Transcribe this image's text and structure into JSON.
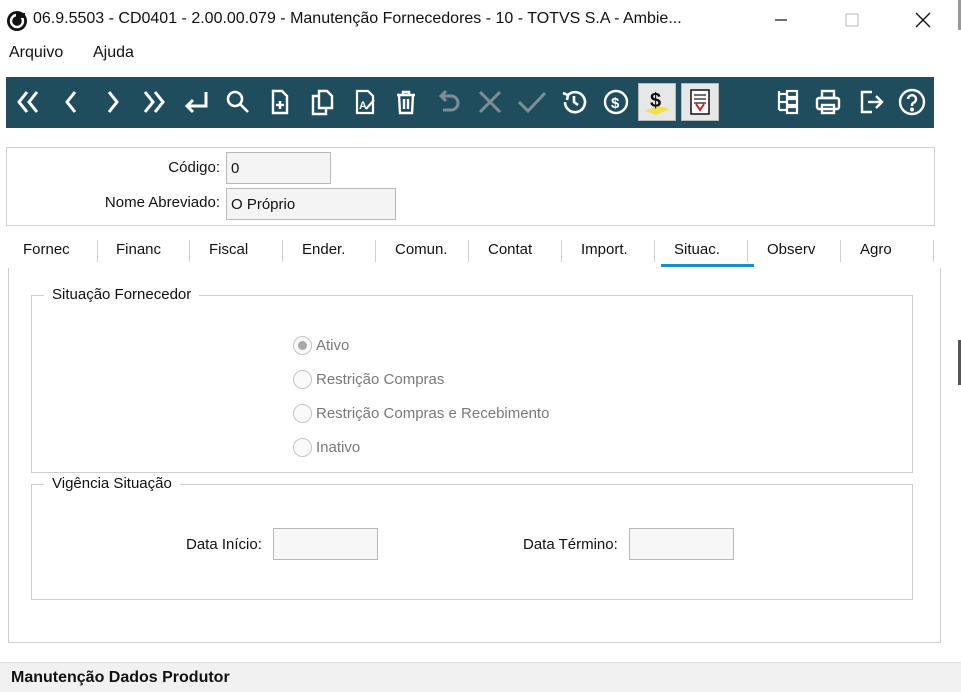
{
  "window": {
    "title": "06.9.5503 - CD0401 - 2.00.00.079 - Manutenção Fornecedores - 10 - TOTVS S.A - Ambie...",
    "controls": {
      "minimize": "minimize-icon",
      "maximize": "maximize-icon",
      "close": "close-icon"
    }
  },
  "menu": {
    "items": [
      "Arquivo",
      "Ajuda"
    ]
  },
  "toolbar": {
    "background": "#1f4d5e",
    "buttons": [
      "first-record-icon",
      "previous-record-icon",
      "next-record-icon",
      "last-record-icon",
      "goto-icon",
      "search-icon",
      "new-record-icon",
      "copy-record-icon",
      "edit-record-icon",
      "delete-icon",
      "undo-icon",
      "cancel-icon",
      "save-icon",
      "history-icon",
      "money-circle-icon",
      "dollar-icon",
      "report-icon",
      "tree-icon",
      "print-icon",
      "exit-icon",
      "help-icon"
    ]
  },
  "header": {
    "codigo_label": "Código:",
    "codigo_value": "0",
    "nome_label": "Nome Abreviado:",
    "nome_value": "O Próprio"
  },
  "tabs": {
    "items": [
      "Fornec",
      "Financ",
      "Fiscal",
      "Ender.",
      "Comun.",
      "Contat",
      "Import.",
      "Situac.",
      "Observ",
      "Agro"
    ],
    "active": "Situac.",
    "active_color": "#1a8fd0"
  },
  "situacao": {
    "group_title": "Situação Fornecedor",
    "options": [
      "Ativo",
      "Restrição Compras",
      "Restrição Compras e Recebimento",
      "Inativo"
    ],
    "selected": "Ativo"
  },
  "vigencia": {
    "group_title": "Vigência Situação",
    "data_inicio_label": "Data Início:",
    "data_inicio_value": "",
    "data_termino_label": "Data Término:",
    "data_termino_value": ""
  },
  "status": {
    "text": "Manutenção Dados Produtor"
  }
}
